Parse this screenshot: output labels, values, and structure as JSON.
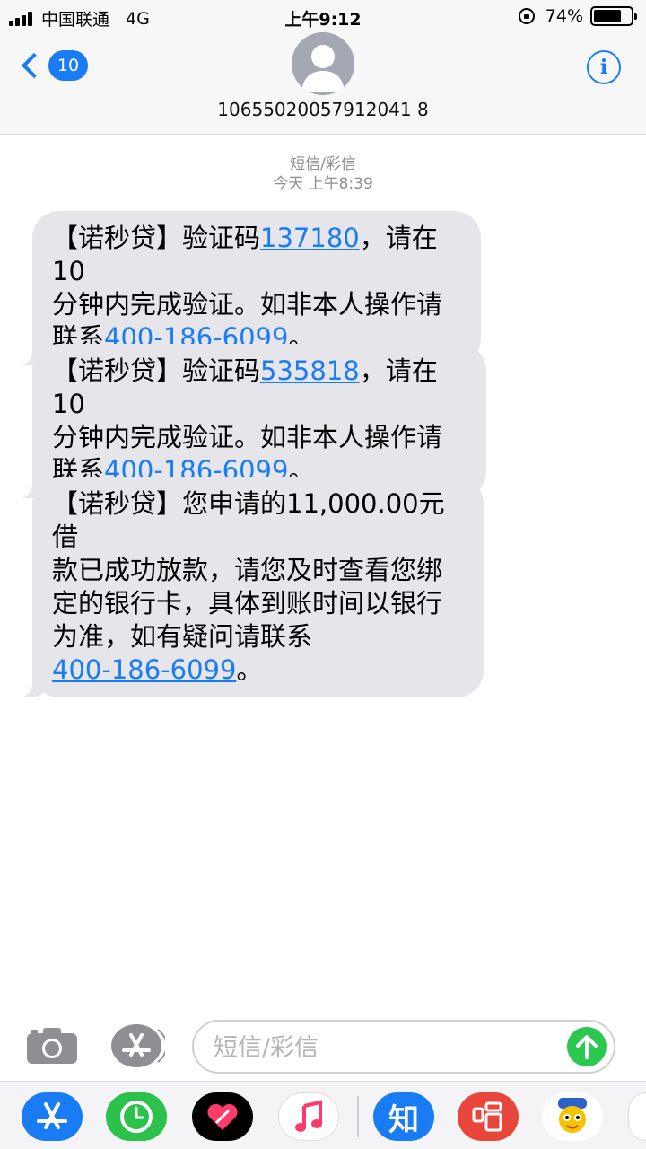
{
  "status_bar": {
    "carrier": "中国联通",
    "network": "4G",
    "time": "上午9:12",
    "battery": "74%",
    "battery_level": 0.74
  },
  "nav": {
    "back_badge": "10",
    "contact_number": "10655020057912041 8",
    "info_label": "i"
  },
  "conversation": {
    "service": "短信/彩信",
    "timestamp": "今天 上午8:39"
  },
  "messages": [
    {
      "p1": "【诺秒贷】验证码",
      "code": "137180",
      "p2": "，请在10",
      "p3": "分钟内完成验证。如非本人操作请",
      "p4": "联系",
      "phone": "400-186-6099",
      "p5": "。"
    },
    {
      "p1": "【诺秒贷】验证码",
      "code": "535818",
      "p2": "，请在10",
      "p3": "分钟内完成验证。如非本人操作请",
      "p4": "联系",
      "phone": "400-186-6099",
      "p5": "。"
    },
    {
      "l1": "【诺秒贷】您申请的11,000.00元借",
      "l2": "款已成功放款，请您及时查看您绑",
      "l3": "定的银行卡，具体到账时间以银行",
      "l4": "为准，如有疑问请联系",
      "phone": "400-186-6099",
      "p5": "。"
    }
  ],
  "input": {
    "placeholder": "短信/彩信"
  },
  "apps": {
    "zhihu_label": "知",
    "colors": {
      "appstore": "#1a7cf5",
      "clock": "#2bc14b",
      "heart": "#000000",
      "music": "#ffffff",
      "zhihu": "#1a7cf5",
      "sing": "#e8463b"
    }
  }
}
